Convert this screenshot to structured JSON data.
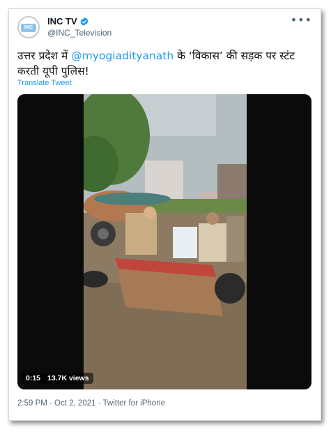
{
  "author": {
    "name": "INC TV",
    "handle": "@INC_Television",
    "avatar_text": "INC"
  },
  "tweet": {
    "text_before": "उत्तर प्रदेश में ",
    "mention": "@myogiadityanath",
    "text_after": " के ‘विकास’ की सड़क पर स्टंट करती यूपी पुलिस!",
    "translate_label": "Translate Tweet"
  },
  "video": {
    "duration": "0:15",
    "views": "13.7K views"
  },
  "meta": {
    "timestamp": "2:59 PM · Oct 2, 2021 · Twitter for iPhone"
  },
  "colors": {
    "accent": "#1d9bf0",
    "text": "#0f1419",
    "secondary": "#536471"
  },
  "icons": {
    "verified": "verified-badge-icon",
    "more": "more-options-icon"
  }
}
